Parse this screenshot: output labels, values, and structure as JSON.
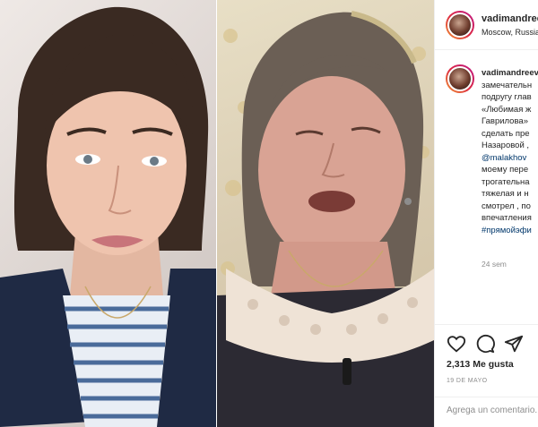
{
  "post": {
    "author": "vadimandreev",
    "location": "Moscow, Russia",
    "caption_lines": [
      {
        "text": "vadimandreev",
        "style": "author"
      },
      {
        "text": "замечательн",
        "style": "text"
      },
      {
        "text": "подругу глав",
        "style": "text"
      },
      {
        "text": "«Любимая ж",
        "style": "text"
      },
      {
        "text": "Гаврилова» ",
        "style": "text"
      },
      {
        "text": "сделать пре",
        "style": "text"
      },
      {
        "text": "Назаровой ,",
        "style": "text"
      },
      {
        "text": "@malakhov",
        "style": "link"
      },
      {
        "text": "моему пере",
        "style": "text"
      },
      {
        "text": "трогательна",
        "style": "text"
      },
      {
        "text": "тяжелая и н",
        "style": "text"
      },
      {
        "text": "смотрел , по",
        "style": "text"
      },
      {
        "text": "впечатления",
        "style": "text"
      },
      {
        "text": "#прямойэфи",
        "style": "link"
      }
    ],
    "time_ago": "24 sem",
    "likes": "2,313 Me gusta",
    "date": "19 DE MAYO",
    "comment_placeholder": "Agrega un comentario..."
  },
  "icons": {
    "like": "heart-icon",
    "comment": "comment-bubble-icon",
    "share": "paper-plane-icon"
  }
}
